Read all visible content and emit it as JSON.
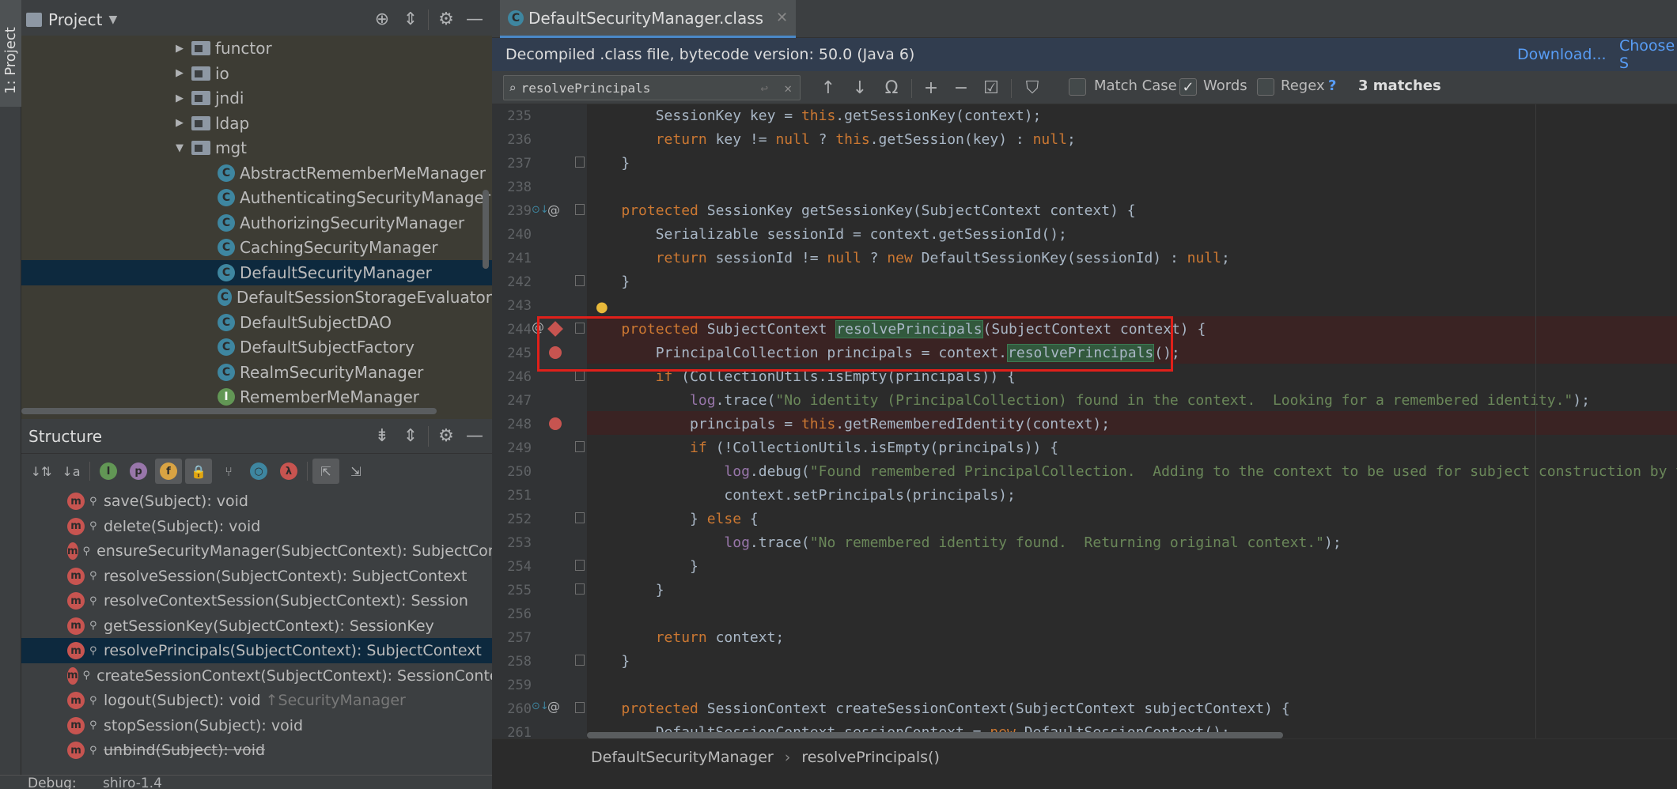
{
  "sidebar_stripe": {
    "label": "1: Project"
  },
  "project": {
    "title": "Project",
    "tree": [
      {
        "label": "functor",
        "type": "folder",
        "level": 1
      },
      {
        "label": "io",
        "type": "folder",
        "level": 1
      },
      {
        "label": "jndi",
        "type": "folder",
        "level": 1
      },
      {
        "label": "ldap",
        "type": "folder",
        "level": 1
      },
      {
        "label": "mgt",
        "type": "folder",
        "level": 1,
        "expanded": true
      },
      {
        "label": "AbstractRememberMeManager",
        "type": "class",
        "level": 2
      },
      {
        "label": "AuthenticatingSecurityManager",
        "type": "class",
        "level": 2
      },
      {
        "label": "AuthorizingSecurityManager",
        "type": "class",
        "level": 2
      },
      {
        "label": "CachingSecurityManager",
        "type": "class",
        "level": 2
      },
      {
        "label": "DefaultSecurityManager",
        "type": "class",
        "level": 2,
        "selected": true
      },
      {
        "label": "DefaultSessionStorageEvaluator",
        "type": "class",
        "level": 2
      },
      {
        "label": "DefaultSubjectDAO",
        "type": "class",
        "level": 2
      },
      {
        "label": "DefaultSubjectFactory",
        "type": "class",
        "level": 2
      },
      {
        "label": "RealmSecurityManager",
        "type": "class",
        "level": 2
      },
      {
        "label": "RememberMeManager",
        "type": "interface",
        "level": 2
      }
    ]
  },
  "structure": {
    "title": "Structure",
    "items": [
      {
        "label": "save(Subject): void"
      },
      {
        "label": "delete(Subject): void"
      },
      {
        "label": "ensureSecurityManager(SubjectContext): SubjectContext"
      },
      {
        "label": "resolveSession(SubjectContext): SubjectContext"
      },
      {
        "label": "resolveContextSession(SubjectContext): Session"
      },
      {
        "label": "getSessionKey(SubjectContext): SessionKey"
      },
      {
        "label": "resolvePrincipals(SubjectContext): SubjectContext",
        "selected": true
      },
      {
        "label": "createSessionContext(SubjectContext): SessionContext"
      },
      {
        "label": "logout(Subject): void",
        "suffix": "↑SecurityManager"
      },
      {
        "label": "stopSession(Subject): void"
      },
      {
        "label": "unbind(Subject): void",
        "strike": true
      }
    ]
  },
  "bottom": {
    "debug": "Debug:",
    "config": "shiro-1.4"
  },
  "editor": {
    "tab": "DefaultSecurityManager.class",
    "banner": "Decompiled .class file, bytecode version: 50.0 (Java 6)",
    "download": "Download...",
    "choose": "Choose S",
    "search": {
      "value": "resolvePrincipals",
      "match_case": "Match Case",
      "words": "Words",
      "regex": "Regex",
      "help": "?",
      "matches": "3 matches",
      "words_checked": true
    },
    "breadcrumb": [
      "DefaultSecurityManager",
      "resolvePrincipals()"
    ]
  },
  "code_lines": [
    {
      "n": "235",
      "html": "        SessionKey key = <span class='kw'>this</span>.getSessionKey(context);"
    },
    {
      "n": "236",
      "html": "        <span class='kw'>return</span> key != <span class='kw'>null</span> ? <span class='kw'>this</span>.getSession(key) : <span class='kw'>null</span>;"
    },
    {
      "n": "237",
      "html": "    }"
    },
    {
      "n": "238",
      "html": ""
    },
    {
      "n": "239",
      "html": "    <span class='kw'>protected</span> SessionKey getSessionKey(SubjectContext context) {"
    },
    {
      "n": "240",
      "html": "        Serializable sessionId = context.getSessionId();"
    },
    {
      "n": "241",
      "html": "        <span class='kw'>return</span> sessionId != <span class='kw'>null</span> ? <span class='kw'>new</span> DefaultSessionKey(sessionId) : <span class='kw'>null</span>;"
    },
    {
      "n": "242",
      "html": "    }"
    },
    {
      "n": "243",
      "html": ""
    },
    {
      "n": "244",
      "html": "    <span class='kw'>protected</span> SubjectContext <span class='hl'>resolvePrincipals</span>(SubjectContext context) {"
    },
    {
      "n": "245",
      "html": "        PrincipalCollection principals = context.<span class='hl'>resolvePrincipals</span>();"
    },
    {
      "n": "246",
      "html": "        <span class='kw'>if</span> (CollectionUtils.isEmpty(principals)) {"
    },
    {
      "n": "247",
      "html": "            <span class='fld'>log</span>.trace(<span class='str'>\"No identity (PrincipalCollection) found in the context.  Looking for a remembered identity.\"</span>);"
    },
    {
      "n": "248",
      "html": "            principals = <span class='kw'>this</span>.getRememberedIdentity(context);"
    },
    {
      "n": "249",
      "html": "            <span class='kw'>if</span> (!CollectionUtils.isEmpty(principals)) {"
    },
    {
      "n": "250",
      "html": "                <span class='fld'>log</span>.debug(<span class='str'>\"Found remembered PrincipalCollection.  Adding to the context to be used for subject construction by the SubjectFactory.\"</span>);"
    },
    {
      "n": "251",
      "html": "                context.setPrincipals(principals);"
    },
    {
      "n": "252",
      "html": "            } <span class='kw'>else</span> {"
    },
    {
      "n": "253",
      "html": "                <span class='fld'>log</span>.trace(<span class='str'>\"No remembered identity found.  Returning original context.\"</span>);"
    },
    {
      "n": "254",
      "html": "            }"
    },
    {
      "n": "255",
      "html": "        }"
    },
    {
      "n": "256",
      "html": ""
    },
    {
      "n": "257",
      "html": "        <span class='kw'>return</span> context;"
    },
    {
      "n": "258",
      "html": "    }"
    },
    {
      "n": "259",
      "html": ""
    },
    {
      "n": "260",
      "html": "    <span class='kw'>protected</span> SessionContext createSessionContext(SubjectContext subjectContext) {"
    },
    {
      "n": "261",
      "html": "        DefaultSessionContext sessionContext = <span class='kw'>new</span> DefaultSessionContext();"
    }
  ],
  "colors": {
    "selection": "#0D293E",
    "breakpoint": "#C75450",
    "highlight": "#32593D",
    "annotation_box": "#E0201A"
  }
}
